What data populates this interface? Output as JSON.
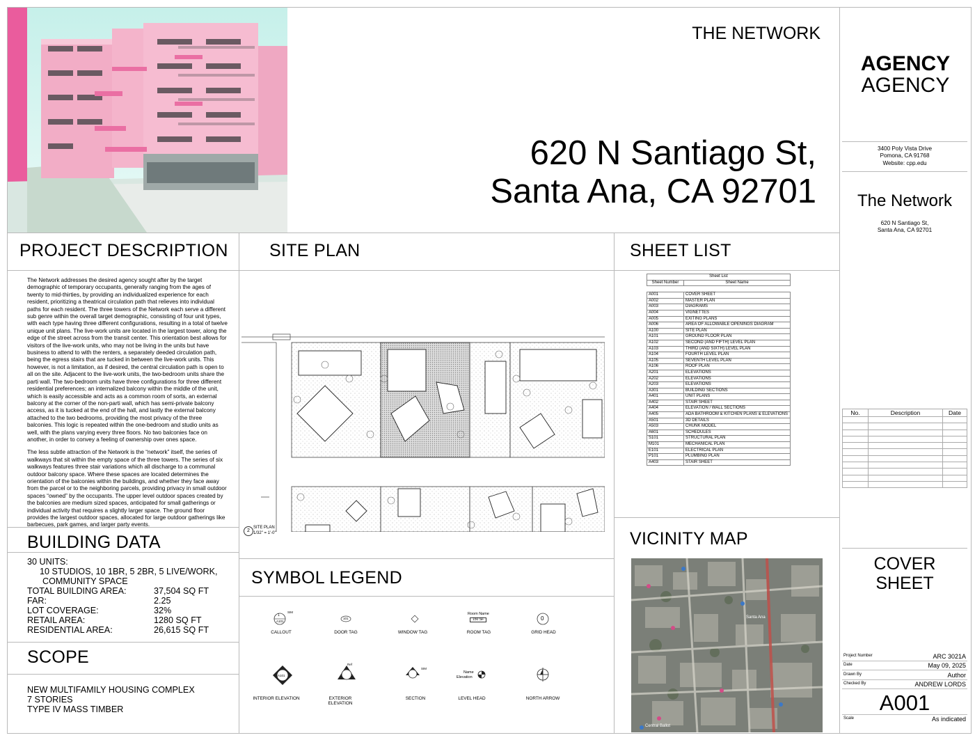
{
  "title_block_top": {
    "project_name_caps": "THE NETWORK",
    "address_line1": "620 N Santiago St,",
    "address_line2": "Santa Ana, CA 92701"
  },
  "agency": {
    "logo_line1": "AGENCY",
    "logo_line2": "AGENCY",
    "address": [
      "3400 Poly Vista Drive",
      "Pomona, CA 91768",
      "Website: cpp.edu"
    ]
  },
  "project_block": {
    "name": "The Network",
    "address": [
      "620 N Santiago St,",
      "Santa Ana, CA 92701"
    ]
  },
  "sections": {
    "project_description": "PROJECT DESCRIPTION",
    "site_plan": "SITE PLAN",
    "sheet_list": "SHEET LIST",
    "building_data": "BUILDING DATA",
    "scope": "SCOPE",
    "symbol_legend": "SYMBOL LEGEND",
    "vicinity_map": "VICINITY MAP"
  },
  "description": {
    "p1": "The Network addresses the desired agency sought after by the target demographic of temporary occupants, generally ranging from the ages of twenty to mid-thirties, by providing an individualized experience for each resident, prioritizing a theatrical circulation path that relieves into individual paths for each resident. The three towers of the Network each serve a different sub genre within the overall target demographic, consisting of four unit types, with each type having three different configurations, resulting in a total of twelve unique unit plans. The live-work units are located in the largest tower, along the edge of the street across from the transit center. This orientation best allows for visitors of the live-work units, who may not be living in the units but have business to attend to with the renters, a separately deeded circulation path, being the egress stairs that are tucked in between the live-work units. This however, is not a limitation, as if desired, the central circulation path is open to all on the site. Adjacent to the live-work units, the two-bedroom units share the parti wall. The two-bedroom units have three configurations for three different residential preferences; an internalized balcony within the middle of the unit, which is easily accessible and acts as a common room of sorts, an external balcony at the corner of the non-parti wall, which has semi-private balcony access, as it is tucked at the end of the hall, and lastly the external balcony attached to the two bedrooms, providing the most privacy of the three balconies. This logic is repeated within the one-bedroom and studio units as well, with the plans varying every three floors. No two balconies face on another, in order to convey a feeling of ownership over ones space.",
    "p2": "The less subtle attraction of the Network is the “network” itself, the series of walkways that sit within the empty space of the three towers. The series of six walkways features three stair variations which all discharge to a communal outdoor balcony space. Where these spaces are located determines the orientation of the balconies within the buildings, and whether they face away from the parcel or to the neighboring parcels, providing privacy in small outdoor spaces “owned” by the occupants. The upper level outdoor spaces created by the balconies are medium sized spaces, anticipated for small gatherings or individual activity that requires a slightly larger space. The ground floor provides the largest outdoor spaces, allocated for large outdoor gatherings like barbecues, park games, and larger party events."
  },
  "building_data": {
    "units_label": "30 UNITS:",
    "units_detail": "10 STUDIOS, 10 1BR, 5 2BR, 5 LIVE/WORK,",
    "units_detail2": "COMMUNITY SPACE",
    "rows": [
      {
        "k": "TOTAL BUILDING AREA:",
        "v": "37,504 SQ FT"
      },
      {
        "k": "FAR:",
        "v": "2.25"
      },
      {
        "k": "LOT COVERAGE:",
        "v": "32%"
      },
      {
        "k": "RETAIL AREA:",
        "v": "1280 SQ FT"
      },
      {
        "k": "RESIDENTIAL AREA:",
        "v": "26,615 SQ FT"
      }
    ]
  },
  "scope": [
    "NEW MULTIFAMILY HOUSING COMPLEX",
    "7 STORIES",
    "TYPE IV MASS TIMBER"
  ],
  "site_plan_tag": {
    "num": "2",
    "name": "SITE PLAN",
    "scale": "1/32\" = 1'-0\""
  },
  "sheet_list": {
    "title": "Sheet List",
    "col_number": "Sheet Number",
    "col_name": "Sheet Name",
    "rows": [
      [
        "A001",
        "COVER SHEET"
      ],
      [
        "A002",
        "MASTER PLAN"
      ],
      [
        "A003",
        "DIAGRAMS"
      ],
      [
        "A004",
        "VIGNETTES"
      ],
      [
        "A005",
        "EXITING PLANS"
      ],
      [
        "A006",
        "AREA OF ALLOWABLE OPENINGS DIAGRAM"
      ],
      [
        "A100",
        "SITE PLAN"
      ],
      [
        "A101",
        "GROUND FLOOR PLAN"
      ],
      [
        "A102",
        "SECOND (AND FIFTH) LEVEL PLAN"
      ],
      [
        "A103",
        "THIRD (AND SIXTH) LEVEL PLAN"
      ],
      [
        "A104",
        "FOURTH LEVEL PLAN"
      ],
      [
        "A105",
        "SEVENTH LEVEL PLAN"
      ],
      [
        "A106",
        "ROOF PLAN"
      ],
      [
        "A201",
        "ELEVATIONS"
      ],
      [
        "A202",
        "ELEVATIONS"
      ],
      [
        "A203",
        "ELEVATIONS"
      ],
      [
        "A301",
        "BUILDING SECTIONS"
      ],
      [
        "A401",
        "UNIT PLANS"
      ],
      [
        "A402",
        "STAIR SHEET"
      ],
      [
        "A404",
        "ELEVATION / WALL SECTIONS"
      ],
      [
        "A405",
        "ADA BATHROOM & KITCHEN PLANS & ELEVATIONS"
      ],
      [
        "A501",
        "3D DETAILS"
      ],
      [
        "A503",
        "CHUNK MODEL"
      ],
      [
        "A601",
        "SCHEDULES"
      ],
      [
        "S101",
        "STRUCTURAL PLAN"
      ],
      [
        "M101",
        "MECHANICAL PLAN"
      ],
      [
        "E101",
        "ELECTRICAL PLAN"
      ],
      [
        "P101",
        "PLUMBING PLAN"
      ],
      [
        "A403",
        "STAIR SHEET"
      ]
    ]
  },
  "symbols": {
    "callout": "CALLOUT",
    "door_tag": "DOOR TAG",
    "window_tag": "WINDOW TAG",
    "room_tag": "ROOM TAG",
    "grid_head": "GRID HEAD",
    "interior_elevation": "INTERIOR ELEVATION",
    "exterior_elevation": "EXTERIOR ELEVATION",
    "section": "SECTION",
    "level_head": "LEVEL HEAD",
    "north_arrow": "NORTH ARROW",
    "room_name": "Room Name",
    "room_area": "150 SF",
    "door_num": "101",
    "grid_num": "0",
    "level_name": "Name",
    "level_elev": "Elevation",
    "sim": "SIM",
    "ref": "Ref",
    "sheet_ref": "A101",
    "callout_num": "1"
  },
  "vicinity": {
    "labels": [
      "Santa Ana",
      "Central Ballot"
    ]
  },
  "revisions": {
    "col_no": "No.",
    "col_desc": "Description",
    "col_date": "Date"
  },
  "sheet_title": {
    "line1": "COVER",
    "line2": "SHEET"
  },
  "title_block": {
    "project_number_label": "Project Number",
    "project_number": "ARC 3021A",
    "date_label": "Date",
    "date": "May 09, 2025",
    "drawn_by_label": "Drawn By",
    "drawn_by": "Author",
    "checked_by_label": "Checked By",
    "checked_by": "ANDREW LORDS",
    "sheet_number": "A001",
    "scale_label": "Scale",
    "scale": "As indicated"
  },
  "colors": {
    "building_pink": "#f1a9c3",
    "sky": "#d6f3ee",
    "accent_pink": "#e8579a"
  }
}
